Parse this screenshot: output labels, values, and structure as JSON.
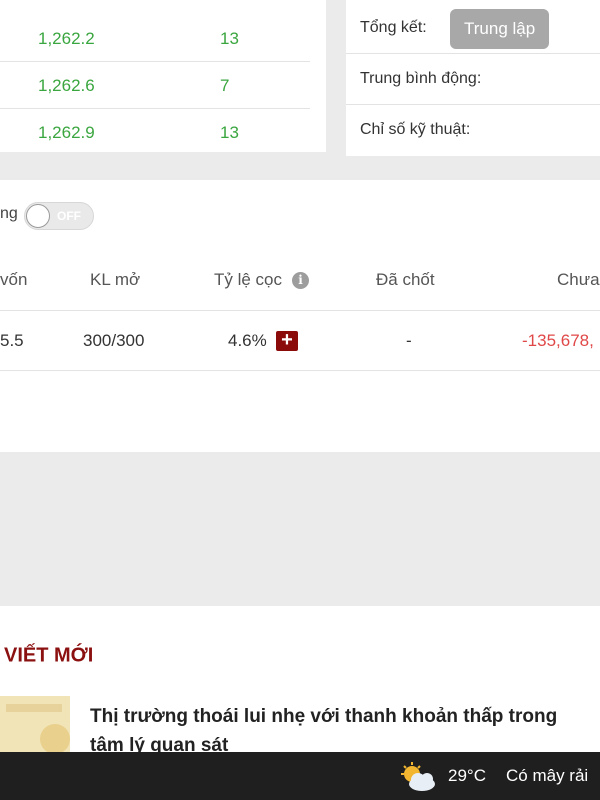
{
  "order_book": {
    "rows": [
      {
        "price": "1,262.2",
        "qty": "13"
      },
      {
        "price": "1,262.6",
        "qty": "7"
      },
      {
        "price": "1,262.9",
        "qty": "13"
      }
    ]
  },
  "technical": {
    "summary_label": "Tổng kết:",
    "summary_value": "Trung lập",
    "moving_avg_label": "Trung bình động:",
    "indicators_label": "Chỉ số kỹ thuật:"
  },
  "positions": {
    "toggle_label": "ng",
    "toggle_state": "OFF",
    "columns": {
      "capital": "vốn",
      "open_qty": "KL mở",
      "margin_ratio": "Tỷ lệ cọc",
      "closed": "Đã chốt",
      "unrealized": "Chưa"
    },
    "row": {
      "capital": "5.5",
      "open_qty": "300/300",
      "margin_ratio": "4.6%",
      "closed": "-",
      "unrealized": "-135,678,"
    },
    "colors": {
      "loss": "#e04848",
      "add_button": "#8b0a0a"
    }
  },
  "news": {
    "heading": "VIẾT MỚI",
    "article_title": "Thị trường thoái lui nhẹ với thanh khoản thấp trong tâm lý quan sát"
  },
  "taskbar": {
    "weather_icon": "partly-cloudy-icon",
    "temperature": "29°C",
    "weather_desc": "Có mây rải"
  }
}
